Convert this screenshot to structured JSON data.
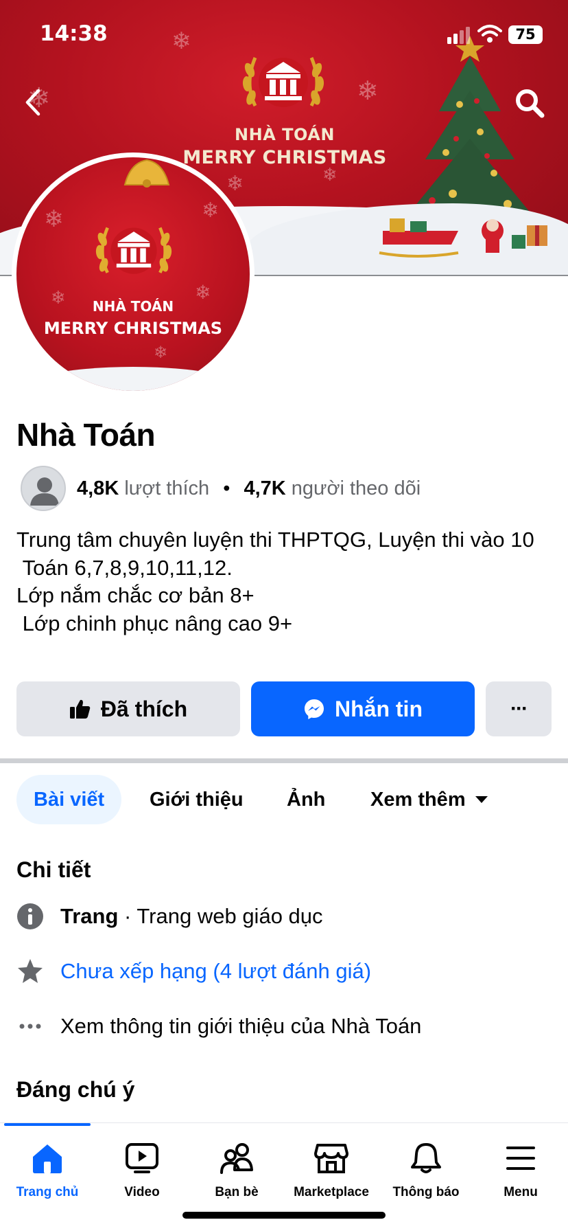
{
  "status_bar": {
    "time": "14:38",
    "battery": "75"
  },
  "cover": {
    "brand_name": "NHÀ TOÁN",
    "brand_tagline": "MERRY CHRISTMAS"
  },
  "avatar": {
    "brand_name": "NHÀ TOÁN",
    "brand_tagline": "MERRY CHRISTMAS"
  },
  "profile": {
    "name": "Nhà Toán",
    "likes_count": "4,8K",
    "likes_label": "lượt thích",
    "bullet": "•",
    "followers_count": "4,7K",
    "followers_label": "người theo dõi",
    "bio": "Trung tâm chuyên luyện thi THPTQG, Luyện thi vào 10\n Toán 6,7,8,9,10,11,12.\nLớp nắm chắc cơ bản 8+\n Lớp chinh phục nâng cao 9+"
  },
  "actions": {
    "liked_label": "Đã thích",
    "message_label": "Nhắn tin",
    "more_label": "···"
  },
  "tabs": [
    {
      "label": "Bài viết",
      "active": true
    },
    {
      "label": "Giới thiệu"
    },
    {
      "label": "Ảnh"
    },
    {
      "label": "Xem thêm"
    }
  ],
  "details": {
    "title": "Chi tiết",
    "category_strong": "Trang",
    "category_rest": " · Trang web giáo dục",
    "rating": "Chưa xếp hạng (4 lượt đánh giá)",
    "see_about": "Xem thông tin giới thiệu của Nhà Toán"
  },
  "featured": {
    "title": "Đáng chú ý"
  },
  "bottom_nav": [
    {
      "label": "Trang chủ",
      "icon": "home-icon",
      "active": true
    },
    {
      "label": "Video",
      "icon": "video-icon"
    },
    {
      "label": "Bạn bè",
      "icon": "friends-icon"
    },
    {
      "label": "Marketplace",
      "icon": "marketplace-icon"
    },
    {
      "label": "Thông báo",
      "icon": "bell-icon"
    },
    {
      "label": "Menu",
      "icon": "menu-icon"
    }
  ],
  "colors": {
    "accent": "#0866ff",
    "cover_red": "#b3121f",
    "button_gray": "#e4e6eb"
  }
}
